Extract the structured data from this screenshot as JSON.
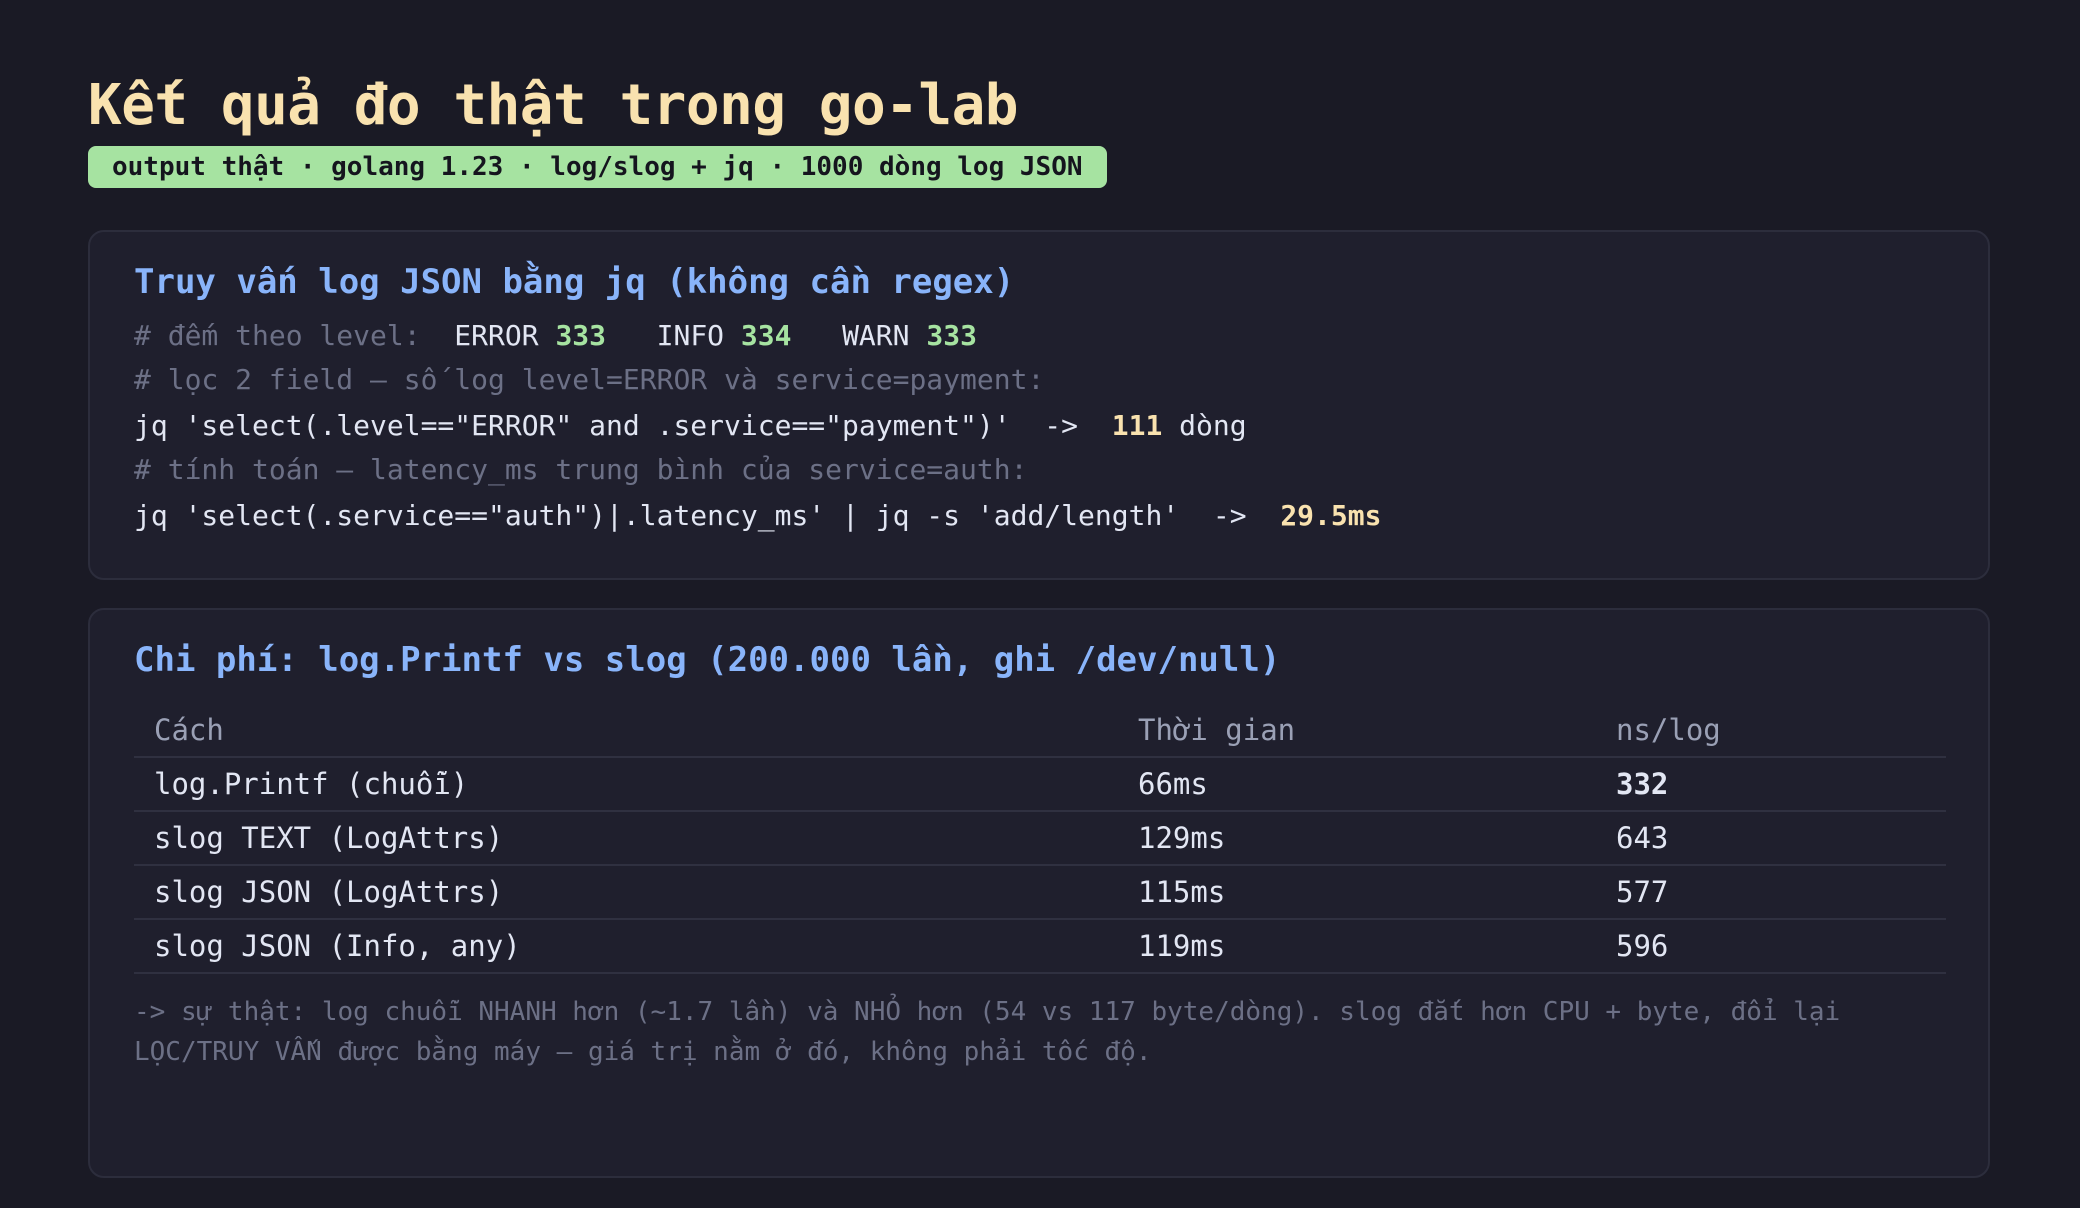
{
  "title": "Kết quả đo thật trong go-lab",
  "badge": "output thật · golang 1.23 · log/slog + jq · 1000 dòng log JSON",
  "jq_card": {
    "heading": "Truy vấn log JSON bằng jq (không cần regex)",
    "count_comment": "# đếm theo level:",
    "levels": [
      {
        "name": "ERROR",
        "count": "333"
      },
      {
        "name": "INFO",
        "count": "334"
      },
      {
        "name": "WARN",
        "count": "333"
      }
    ],
    "filter_comment": "# lọc 2 field – số log level=ERROR và service=payment:",
    "filter_command": "jq 'select(.level==\"ERROR\" and .service==\"payment\")'  ->  ",
    "filter_result": "111",
    "filter_unit": " dòng",
    "compute_comment": "# tính toán – latency_ms trung bình của service=auth:",
    "compute_command": "jq 'select(.service==\"auth\")|.latency_ms' | jq -s 'add/length'  ->  ",
    "compute_result": "29.5ms"
  },
  "cost_card": {
    "heading": "Chi phí: log.Printf vs slog (200.000 lần, ghi /dev/null)",
    "columns": [
      "Cách",
      "Thời gian",
      "ns/log"
    ],
    "rows": [
      {
        "method": "log.Printf (chuỗi)",
        "time": "66ms",
        "ns": "332",
        "highlight": "green"
      },
      {
        "method": "slog TEXT (LogAttrs)",
        "time": "129ms",
        "ns": "643",
        "highlight": "none"
      },
      {
        "method": "slog JSON (LogAttrs)",
        "time": "115ms",
        "ns": "577",
        "highlight": "orange"
      },
      {
        "method": "slog JSON (Info, any)",
        "time": "119ms",
        "ns": "596",
        "highlight": "none"
      }
    ],
    "note": "-> sự thật: log chuỗi NHANH hơn (~1.7 lần) và NHỎ hơn (54 vs 117 byte/dòng). slog đắt hơn CPU + byte, đổi lại LỌC/TRUY VẤN được bằng máy – giá trị nằm ở đó, không phải tốc độ."
  },
  "colors": {
    "background": "#1a1a25",
    "title": "#f9e2af",
    "badge": "#a6e3a1",
    "heading": "#89b4fa",
    "green": "#a6e3a1",
    "orange": "#fab387"
  }
}
